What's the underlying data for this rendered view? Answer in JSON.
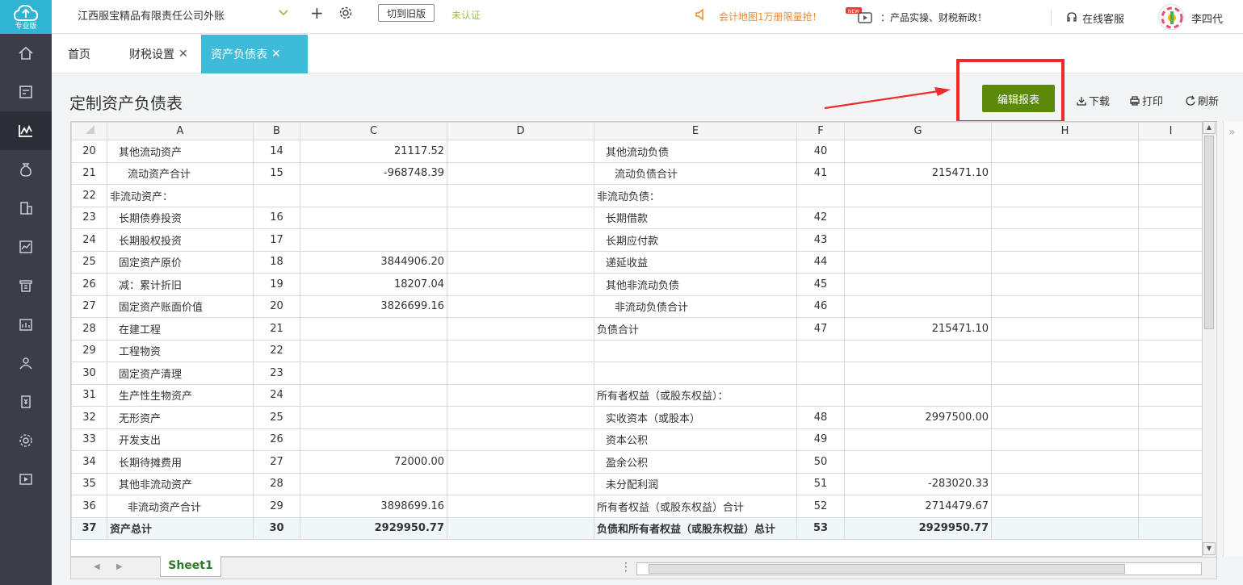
{
  "logo": {
    "text": "专业版"
  },
  "topbar": {
    "company": "江西服宝精品有限责任公司外账",
    "switch_old": "切到旧版",
    "cert": "未认证",
    "promo1": "会计地图1万册限量抢！",
    "promo2": "：产品实操、财税新政！",
    "support": "在线客服",
    "username": "李四代"
  },
  "tabs": [
    {
      "label": "首页"
    },
    {
      "label": "财税设置"
    },
    {
      "label": "资产负债表"
    }
  ],
  "page": {
    "title": "定制资产负债表",
    "edit_button": "编辑报表",
    "download": "下载",
    "print": "打印",
    "refresh": "刷新"
  },
  "columns": [
    "A",
    "B",
    "C",
    "D",
    "E",
    "F",
    "G",
    "H",
    "I"
  ],
  "rows": [
    {
      "n": "20",
      "a": "其他流动资产",
      "ai": 1,
      "b": "14",
      "c": "21117.52",
      "e": "其他流动负债",
      "ei": 1,
      "f": "40",
      "g": ""
    },
    {
      "n": "21",
      "a": "流动资产合计",
      "ai": 2,
      "b": "15",
      "c": "-968748.39",
      "e": "流动负债合计",
      "ei": 2,
      "f": "41",
      "g": "215471.10"
    },
    {
      "n": "22",
      "a": "非流动资产：",
      "ai": 0,
      "b": "",
      "c": "",
      "e": "非流动负债：",
      "ei": 0,
      "f": "",
      "g": ""
    },
    {
      "n": "23",
      "a": "长期债券投资",
      "ai": 1,
      "b": "16",
      "c": "",
      "e": "长期借款",
      "ei": 1,
      "f": "42",
      "g": ""
    },
    {
      "n": "24",
      "a": "长期股权投资",
      "ai": 1,
      "b": "17",
      "c": "",
      "e": "长期应付款",
      "ei": 1,
      "f": "43",
      "g": ""
    },
    {
      "n": "25",
      "a": "固定资产原价",
      "ai": 1,
      "b": "18",
      "c": "3844906.20",
      "e": "递延收益",
      "ei": 1,
      "f": "44",
      "g": ""
    },
    {
      "n": "26",
      "a": "减：累计折旧",
      "ai": 1,
      "b": "19",
      "c": "18207.04",
      "e": "其他非流动负债",
      "ei": 1,
      "f": "45",
      "g": ""
    },
    {
      "n": "27",
      "a": "固定资产账面价值",
      "ai": 1,
      "b": "20",
      "c": "3826699.16",
      "e": "非流动负债合计",
      "ei": 2,
      "f": "46",
      "g": ""
    },
    {
      "n": "28",
      "a": "在建工程",
      "ai": 1,
      "b": "21",
      "c": "",
      "e": "负债合计",
      "ei": 0,
      "f": "47",
      "g": "215471.10"
    },
    {
      "n": "29",
      "a": "工程物资",
      "ai": 1,
      "b": "22",
      "c": "",
      "e": "",
      "ei": 0,
      "f": "",
      "g": ""
    },
    {
      "n": "30",
      "a": "固定资产清理",
      "ai": 1,
      "b": "23",
      "c": "",
      "e": "",
      "ei": 0,
      "f": "",
      "g": ""
    },
    {
      "n": "31",
      "a": "生产性生物资产",
      "ai": 1,
      "b": "24",
      "c": "",
      "e": "所有者权益（或股东权益）：",
      "ei": 0,
      "f": "",
      "g": ""
    },
    {
      "n": "32",
      "a": "无形资产",
      "ai": 1,
      "b": "25",
      "c": "",
      "e": "实收资本（或股本）",
      "ei": 1,
      "f": "48",
      "g": "2997500.00"
    },
    {
      "n": "33",
      "a": "开发支出",
      "ai": 1,
      "b": "26",
      "c": "",
      "e": "资本公积",
      "ei": 1,
      "f": "49",
      "g": ""
    },
    {
      "n": "34",
      "a": "长期待摊费用",
      "ai": 1,
      "b": "27",
      "c": "72000.00",
      "e": "盈余公积",
      "ei": 1,
      "f": "50",
      "g": ""
    },
    {
      "n": "35",
      "a": "其他非流动资产",
      "ai": 1,
      "b": "28",
      "c": "",
      "e": "未分配利润",
      "ei": 1,
      "f": "51",
      "g": "-283020.33"
    },
    {
      "n": "36",
      "a": "非流动资产合计",
      "ai": 2,
      "b": "29",
      "c": "3898699.16",
      "e": "所有者权益（或股东权益）合计",
      "ei": 0,
      "f": "52",
      "g": "2714479.67"
    },
    {
      "n": "37",
      "a": "资产总计",
      "ai": 0,
      "b": "30",
      "c": "2929950.77",
      "e": "负债和所有者权益（或股东权益）总计",
      "ei": 0,
      "f": "53",
      "g": "2929950.77",
      "total": true
    }
  ],
  "sheet_tab": "Sheet1"
}
